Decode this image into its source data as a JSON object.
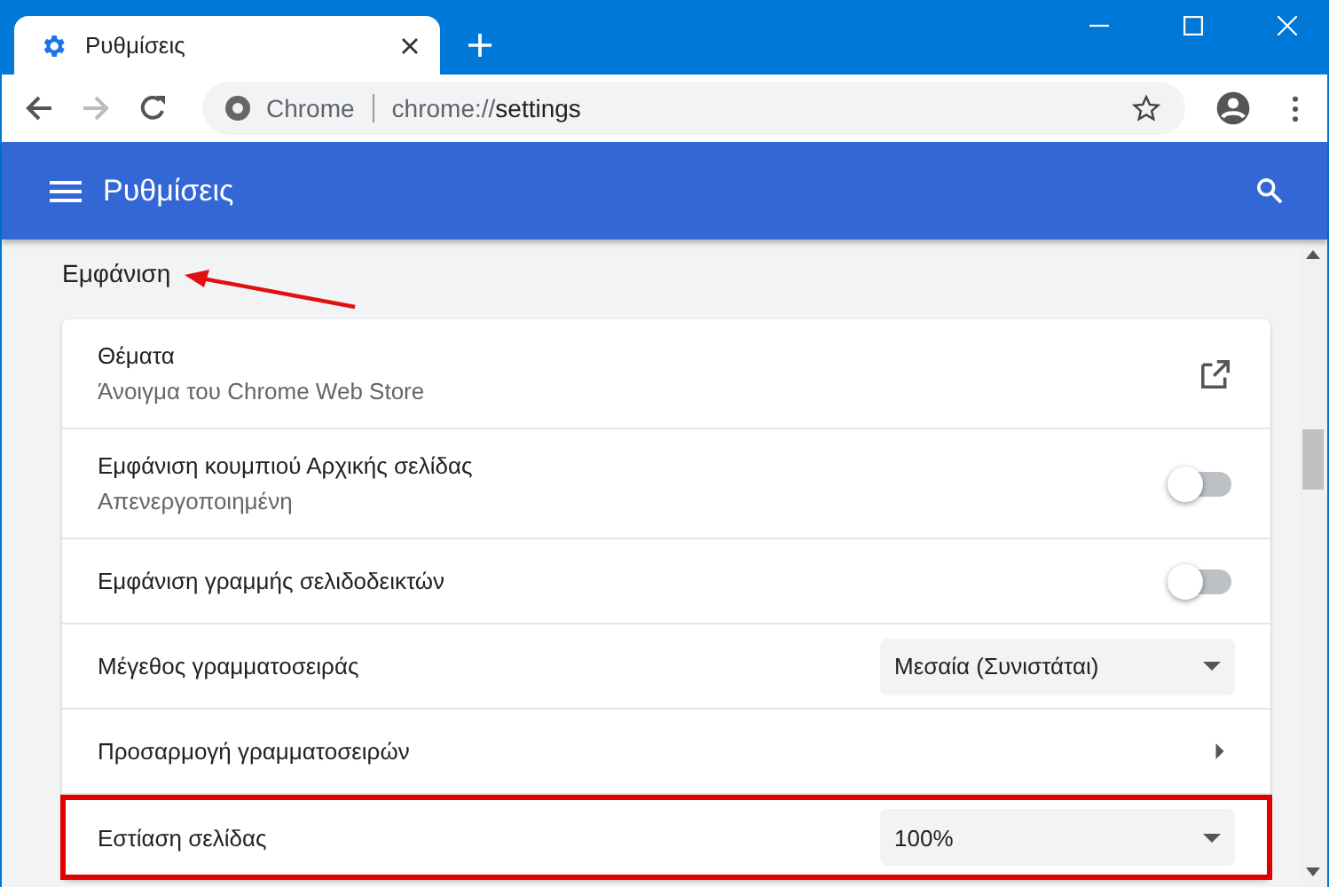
{
  "window": {
    "tab_title": "Ρυθμίσεις"
  },
  "address_bar": {
    "site_label": "Chrome",
    "url_prefix": "chrome://",
    "url_path": "settings"
  },
  "header": {
    "title": "Ρυθμίσεις"
  },
  "section": {
    "title": "Εμφάνιση"
  },
  "rows": [
    {
      "kind": "link",
      "label": "Θέματα",
      "sublabel": "Άνοιγμα του Chrome Web Store",
      "highlighted": false
    },
    {
      "kind": "toggle",
      "label": "Εμφάνιση κουμπιού Αρχικής σελίδας",
      "sublabel": "Απενεργοποιημένη",
      "on": false,
      "highlighted": false
    },
    {
      "kind": "toggle",
      "label": "Εμφάνιση γραμμής σελιδοδεικτών",
      "on": false,
      "highlighted": false
    },
    {
      "kind": "select",
      "label": "Μέγεθος γραμματοσειράς",
      "value": "Μεσαία (Συνιστάται)",
      "highlighted": false
    },
    {
      "kind": "arrow",
      "label": "Προσαρμογή γραμματοσειρών",
      "highlighted": false
    },
    {
      "kind": "select",
      "label": "Εστίαση σελίδας",
      "value": "100%",
      "highlighted": true
    }
  ]
}
